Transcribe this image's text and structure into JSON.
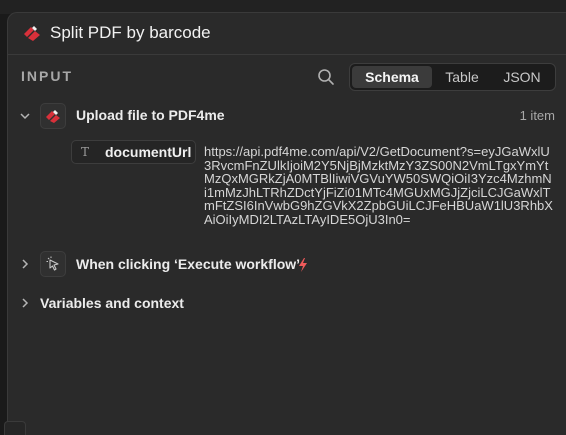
{
  "panel": {
    "title": "Split PDF by barcode"
  },
  "input_section": {
    "header": "INPUT",
    "tabs": [
      {
        "label": "Schema",
        "active": true
      },
      {
        "label": "Table",
        "active": false
      },
      {
        "label": "JSON",
        "active": false
      }
    ]
  },
  "nodes": {
    "upload": {
      "label": "Upload file to PDF4me",
      "count": "1 item",
      "expanded": true,
      "field": {
        "type_icon": "T",
        "name": "documentUrl",
        "value": "https://api.pdf4me.com/api/V2/GetDocument?s=eyJGaWxlU3RvcmFnZUlkIjoiM2Y5NjBjMzktMzY3ZS00N2VmLTgxYmYtMzQxMGRkZjA0MTBlIiwiVGVuYW50SWQiOiI3Yzc4MzhmNi1mMzJhLTRhZDctYjFiZi01MTc4MGUxMGJjZjciLCJGaWxlTmFtZSI6InVwbG9hZGVkX2ZpbGUiLCJFeHBUaW1lU3RhbXAiOiIyMDI2LTAzLTAyIDE5OjU3In0="
      }
    },
    "trigger": {
      "label": "When clicking ‘Execute workflow’",
      "expanded": false,
      "badge_icon": "lightning-icon"
    },
    "variables": {
      "label": "Variables and context",
      "expanded": false
    }
  },
  "colors": {
    "panel_bg": "#2a2a2a",
    "accent_red": "#d8303a",
    "badge_red": "#ef5a5a",
    "active_tab_bg": "#3b3b3b"
  }
}
